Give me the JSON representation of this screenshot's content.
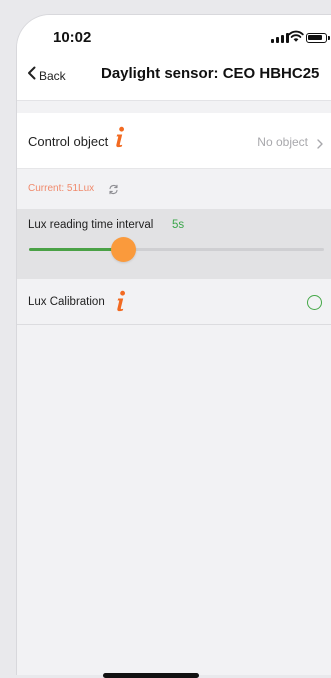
{
  "status_bar": {
    "time": "10:02",
    "icons": [
      "signal-icon",
      "wifi-icon",
      "battery-icon"
    ]
  },
  "nav": {
    "back_label": "Back",
    "title": "Daylight sensor: CEO HBHC25"
  },
  "control_object": {
    "label": "Control object",
    "value": "No object"
  },
  "current": {
    "text": "Current: 51Lux"
  },
  "lux_interval": {
    "label": "Lux reading time interval",
    "value": "5s",
    "slider_fraction": 0.32
  },
  "lux_calibration": {
    "label": "Lux Calibration",
    "checked": false
  },
  "colors": {
    "accent_green": "#3aa64a",
    "info_orange": "#f26a21",
    "current_orange": "#f08a6c",
    "thumb_orange": "#fa9a3c"
  }
}
